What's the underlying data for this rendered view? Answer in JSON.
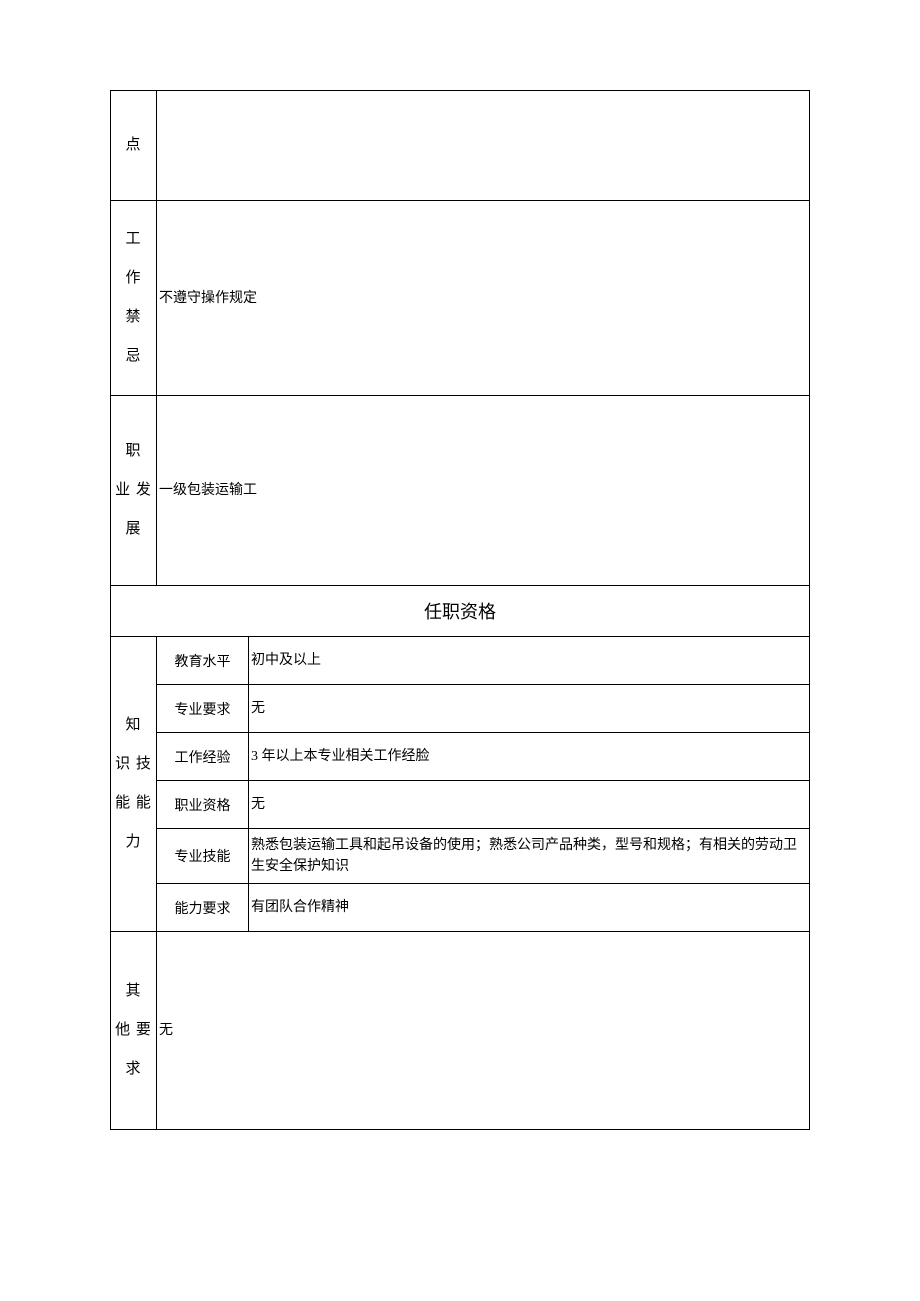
{
  "rows": {
    "r1": {
      "label": "点",
      "content": ""
    },
    "r2": {
      "label": "工作禁忌",
      "content": "不遵守操作规定"
    },
    "r3": {
      "label": "职业发展",
      "content": "一级包装运输工"
    },
    "section": "任职资格",
    "know_label": "知识技能能力",
    "q1": {
      "label": "教育水平",
      "value": "初中及以上"
    },
    "q2": {
      "label": "专业要求",
      "value": "无"
    },
    "q3": {
      "label": "工作经验",
      "value": "3 年以上本专业相关工作经脸"
    },
    "q4": {
      "label": "职业资格",
      "value": "无"
    },
    "q5": {
      "label": "专业技能",
      "value": "熟悉包装运输工具和起吊设备的使用；熟悉公司产品种类，型号和规格；有相关的劳动卫生安全保护知识"
    },
    "q6": {
      "label": "能力要求",
      "value": "有团队合作精神"
    },
    "other": {
      "label": "其他要求",
      "value": "无"
    }
  }
}
